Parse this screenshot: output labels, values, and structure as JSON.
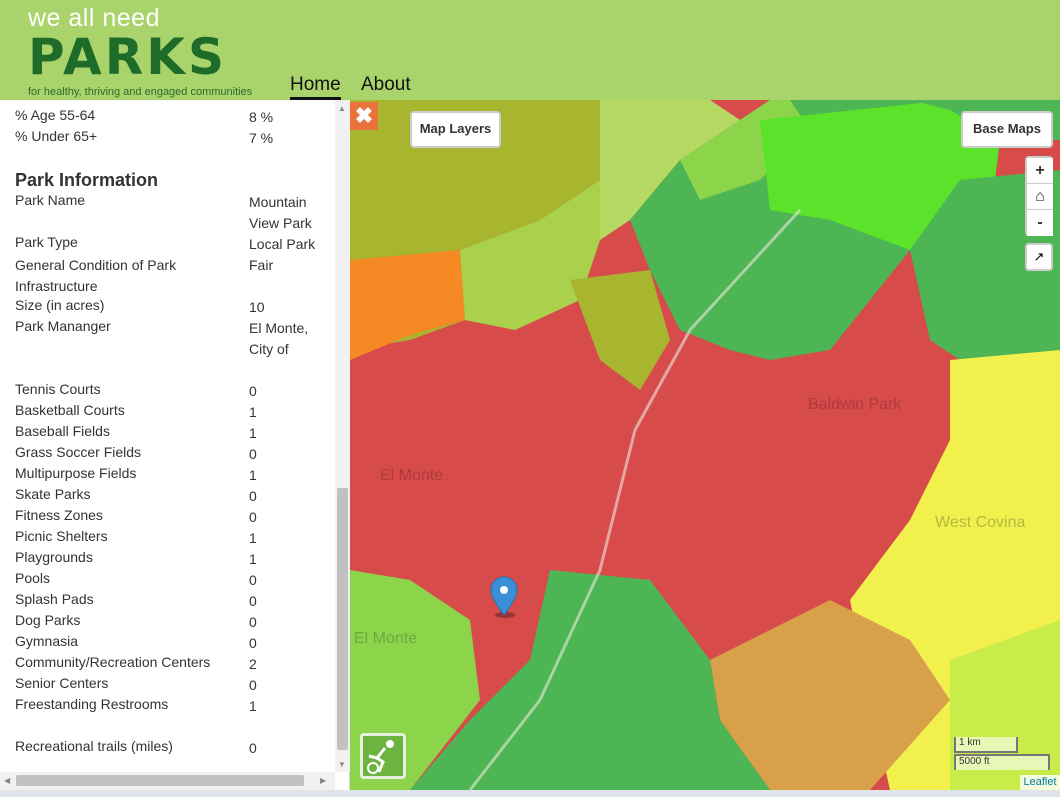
{
  "header": {
    "logo_tagline": "we all need",
    "logo_word": "PARKS",
    "logo_subtitle": "for healthy, thriving and engaged communities",
    "nav": [
      {
        "label": "Home",
        "active": true
      },
      {
        "label": "About",
        "active": false
      }
    ],
    "background_color": "#a9d46b"
  },
  "sidebar": {
    "demographics": [
      {
        "label": "% Age 55-64",
        "value": "8 %"
      },
      {
        "label": "% Under 65+",
        "value": "7 %"
      }
    ],
    "park_info_title": "Park Information",
    "park_info": [
      {
        "label": "Park Name",
        "value": "Mountain View Park"
      },
      {
        "label": "Park Type",
        "value": "Local Park"
      },
      {
        "label": "General Condition of Park Infrastructure",
        "value": "Fair"
      },
      {
        "label": "Size (in acres)",
        "value": "10"
      },
      {
        "label": "Park Mananger",
        "value": "El Monte, City of"
      }
    ],
    "amenities": [
      {
        "label": "Tennis Courts",
        "value": "0"
      },
      {
        "label": "Basketball Courts",
        "value": "1"
      },
      {
        "label": "Baseball Fields",
        "value": "1"
      },
      {
        "label": "Grass Soccer Fields",
        "value": "0"
      },
      {
        "label": "Multipurpose Fields",
        "value": "1"
      },
      {
        "label": "Skate Parks",
        "value": "0"
      },
      {
        "label": "Fitness Zones",
        "value": "0"
      },
      {
        "label": "Picnic Shelters",
        "value": "1"
      },
      {
        "label": "Playgrounds",
        "value": "1"
      },
      {
        "label": "Pools",
        "value": "0"
      },
      {
        "label": "Splash Pads",
        "value": "0"
      },
      {
        "label": "Dog Parks",
        "value": "0"
      },
      {
        "label": "Gymnasia",
        "value": "0"
      },
      {
        "label": "Community/Recreation Centers",
        "value": "2"
      },
      {
        "label": "Senior Centers",
        "value": "0"
      },
      {
        "label": "Freestanding Restrooms",
        "value": "1"
      }
    ],
    "trails": {
      "label": "Recreational trails (miles)",
      "value": "0"
    }
  },
  "map": {
    "close_icon": "close-icon",
    "layers_button": "Map Layers",
    "basemaps_button": "Base Maps",
    "zoom_in": "+",
    "home_icon": "home-icon",
    "zoom_out": "-",
    "share_icon": "share-icon",
    "places": [
      "El Monte",
      "Baldwin Park",
      "West Covina",
      "El Monte"
    ],
    "scale_km": "1 km",
    "scale_ft": "5000 ft",
    "attribution": "Leaflet",
    "marker_icon": "map-marker-icon",
    "sport_icon": "sports-icon",
    "colors": {
      "red": "#d74b4b",
      "green": "#4db553",
      "light_green": "#8cd44a",
      "lime": "#5ae32a",
      "olive": "#a8b52e",
      "orange": "#f58a24",
      "yellow": "#f2f04d",
      "tan": "#d9a04a",
      "park": "#2d6b1f",
      "marker": "#3a8fd6"
    }
  }
}
